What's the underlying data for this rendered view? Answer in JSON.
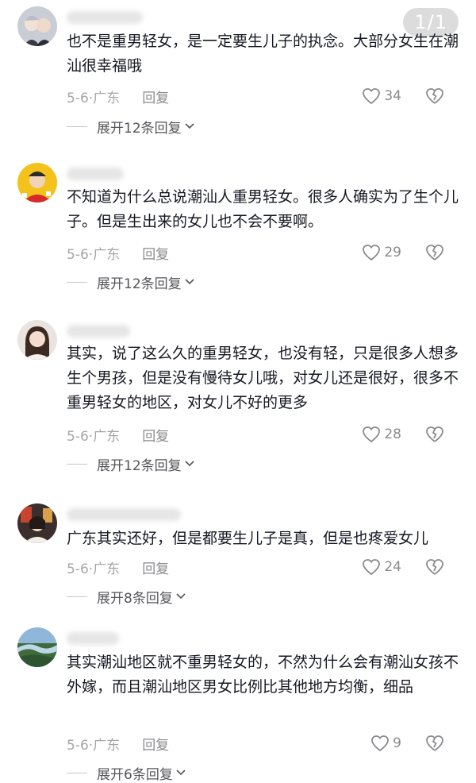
{
  "page_indicator": "1/1",
  "comments": [
    {
      "text": "也不是重男轻女，是一定要生儿子的执念。大部分女生在潮汕很幸福哦",
      "time": "5-6",
      "location": "广东",
      "reply_label": "回复",
      "likes": "34",
      "expand_label": "展开12条回复"
    },
    {
      "text": "不知道为什么总说潮汕人重男轻女。很多人确实为了生个儿子。但是生出来的女儿也不会不要啊。",
      "time": "5-6",
      "location": "广东",
      "reply_label": "回复",
      "likes": "29",
      "expand_label": "展开12条回复"
    },
    {
      "text": "其实，说了这么久的重男轻女，也没有轻，只是很多人想多生个男孩，但是没有慢待女儿哦，对女儿还是很好，很多不重男轻女的地区，对女儿不好的更多",
      "time": "5-6",
      "location": "广东",
      "reply_label": "回复",
      "likes": "28",
      "expand_label": "展开12条回复"
    },
    {
      "text": "广东其实还好，但是都要生儿子是真，但是也疼爱女儿",
      "time": "5-6",
      "location": "广东",
      "reply_label": "回复",
      "likes": "24",
      "expand_label": "展开8条回复"
    },
    {
      "text": "其实潮汕地区就不重男轻女的，不然为什么会有潮汕女孩不外嫁，而且潮汕地区男女比例比其他地方均衡，细品",
      "time": "5-6",
      "location": "广东",
      "reply_label": "回复",
      "likes": "9",
      "expand_label": "展开6条回复"
    }
  ],
  "colors": {
    "text": "#161823",
    "meta": "#a6a6aa",
    "icon": "#8a8a8e"
  },
  "icons": {
    "like": "heart-icon",
    "dislike": "broken-heart-icon",
    "expand": "chevron-down-icon"
  }
}
